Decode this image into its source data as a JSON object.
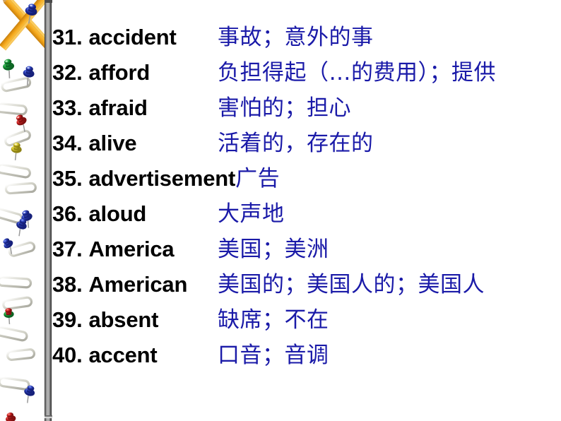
{
  "slide": {
    "background_color": "#ffffff",
    "english_color": "#000000",
    "chinese_color": "#1a1aa8"
  },
  "decoration": {
    "alt": "stationery border: yellow pencils, colored pushpins and silver paperclips",
    "pencil_color": "#f0a818",
    "pencil_wood_color": "#c0873c",
    "pin_colors": [
      "#2a3fb8",
      "#1aa03a",
      "#cc2222",
      "#d8c830",
      "#2a3fb8"
    ],
    "paperclip_color": "#c9c9bf"
  },
  "vocabulary": {
    "entries": [
      {
        "num": "31.",
        "word": "accident",
        "cn": "事故；意外的事"
      },
      {
        "num": "32.",
        "word": "afford",
        "cn": "负担得起（…的费用）；提供"
      },
      {
        "num": "33.",
        "word": "afraid",
        "cn": "害怕的；担心"
      },
      {
        "num": "34.",
        "word": "alive",
        "cn": "活着的，存在的"
      },
      {
        "num": "35.",
        "word": "advertisement",
        "cn": "广告"
      },
      {
        "num": "36.",
        "word": "aloud",
        "cn": "大声地"
      },
      {
        "num": "37.",
        "word": "America",
        "cn": "美国；美洲"
      },
      {
        "num": "38.",
        "word": "American",
        "cn": "美国的；美国人的；美国人"
      },
      {
        "num": "39.",
        "word": "absent",
        "cn": "缺席；不在"
      },
      {
        "num": "40.",
        "word": "accent",
        "cn": "口音；音调"
      }
    ]
  }
}
